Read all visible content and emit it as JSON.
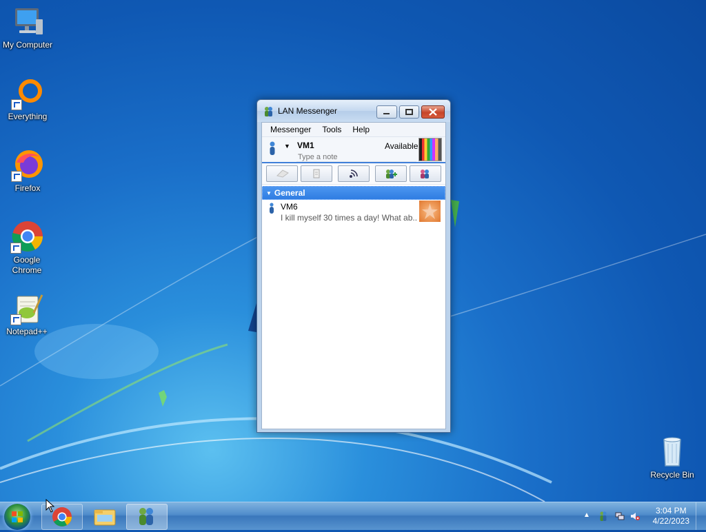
{
  "desktop": {
    "icons": [
      {
        "label": "My Computer"
      },
      {
        "label": "Everything"
      },
      {
        "label": "Firefox"
      },
      {
        "label": "Google Chrome"
      },
      {
        "label": "Notepad++"
      },
      {
        "label": "Recycle Bin"
      }
    ]
  },
  "window": {
    "title": "LAN Messenger",
    "menu": [
      "Messenger",
      "Tools",
      "Help"
    ],
    "status": {
      "user_name": "VM1",
      "presence": "Available",
      "note_placeholder": "Type a note"
    },
    "toolbar": {
      "buttons": [
        {
          "icon": "eraser-icon",
          "enabled": false
        },
        {
          "icon": "file-transfer-icon",
          "enabled": false
        },
        {
          "icon": "broadcast-icon",
          "enabled": true
        },
        {
          "icon": "add-contact-icon",
          "enabled": true
        },
        {
          "icon": "settings-contact-icon",
          "enabled": true
        }
      ]
    },
    "groups": [
      {
        "name": "General",
        "contacts": [
          {
            "name": "VM6",
            "message": "I kill myself 30 times a day! What ab..."
          }
        ]
      }
    ]
  },
  "taskbar": {
    "pinned": [
      "chrome-icon",
      "explorer-icon",
      "lan-messenger-icon"
    ],
    "clock": {
      "time": "3:04 PM",
      "date": "4/22/2023"
    },
    "colors": {
      "accent": "#2f7de2"
    }
  }
}
